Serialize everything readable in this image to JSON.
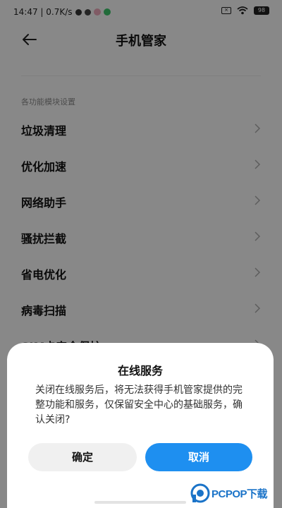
{
  "status_bar": {
    "time_speed": "14:47 | 0.7K/s",
    "battery": "98"
  },
  "header": {
    "title": "手机管家"
  },
  "section_title": "各功能模块设置",
  "menu_items": [
    {
      "label": "垃圾清理"
    },
    {
      "label": "优化加速"
    },
    {
      "label": "网络助手"
    },
    {
      "label": "骚扰拦截"
    },
    {
      "label": "省电优化"
    },
    {
      "label": "病毒扫描"
    },
    {
      "label": "SIM卡安全保护"
    }
  ],
  "dialog": {
    "title": "在线服务",
    "message": "关闭在线服务后，将无法获得手机管家提供的完整功能和服务，仅保留安全中心的基础服务，确认关闭?",
    "confirm_label": "确定",
    "cancel_label": "取消"
  },
  "watermark": "PCPOP下载",
  "colors": {
    "accent": "#1e8ff0",
    "overlay": "rgba(0,0,0,0.45)",
    "background": "#f7f7f7"
  }
}
